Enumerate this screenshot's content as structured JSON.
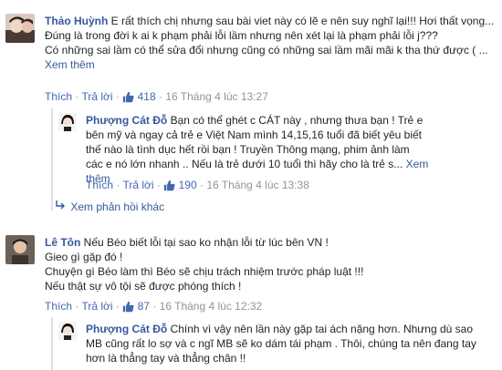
{
  "comments": [
    {
      "name": "Thảo Huỳnh",
      "text": "E rất thích chị nhưng sau bài viet này có lẽ e nên suy nghĩ lại!!! Hơi thất vọng...",
      "text2": "Đúng là trong đời k ai k phạm phải lỗi lầm nhưng nên xét lại là phạm phải lỗi j???",
      "text3": "Có những sai lầm có thể sửa đổi nhưng cũng có những sai lầm mãi mãi k tha thứ được ( ...",
      "see_more": "Xem thêm",
      "like": "Thích",
      "reply": "Trả lời",
      "likes": "418",
      "time": "16 Tháng 4 lúc 13:27"
    },
    {
      "name": "Phượng Cát Đỗ",
      "text": "Bạn có thể ghét c CÁT này , nhưng thưa bạn ! Trẻ e bên mỹ và ngay cả trẻ e Việt Nam mình 14,15,16 tuổi đã biết yêu biết thế nào là tình dục hết rồi bạn ! Truyền Thông mạng, phim ảnh làm các e nó lớn nhanh .. Nếu là trẻ dưới 10 tuổi thì hãy cho là trẻ s...",
      "see_more": "Xem thêm",
      "like": "Thích",
      "reply": "Trả lời",
      "likes": "190",
      "time": "16 Tháng 4 lúc 13:38"
    },
    {
      "name": "Lê Tôn",
      "text": "Nếu Béo biết lỗi tại sao ko nhận lỗi từ lúc bên VN !",
      "text2": "Gieo gì gặp đó !",
      "text3": "Chuyện gì Béo làm thì Béo sẽ chịu trách nhiệm trước pháp luật !!! Nếu thật sự vô tội sẽ được phóng thích !",
      "like": "Thích",
      "reply": "Trả lời",
      "likes": "87",
      "time": "16 Tháng 4 lúc 12:32"
    },
    {
      "name": "Phượng Cát Đỗ",
      "text": "Chính vì vậy nên lần này gặp tai ách nặng hơn. Nhưng dù sao MB cũng rất lo sợ và c ngĩ MB sẽ ko dám tái phạm . Thôi, chúng ta nên đang tay hơn là thẳng tay và thẳng chân !!"
    }
  ],
  "more_replies": "Xem phản hồi khác",
  "colors": {
    "link": "#365899",
    "meta": "#90949c",
    "text": "#1d2129"
  }
}
